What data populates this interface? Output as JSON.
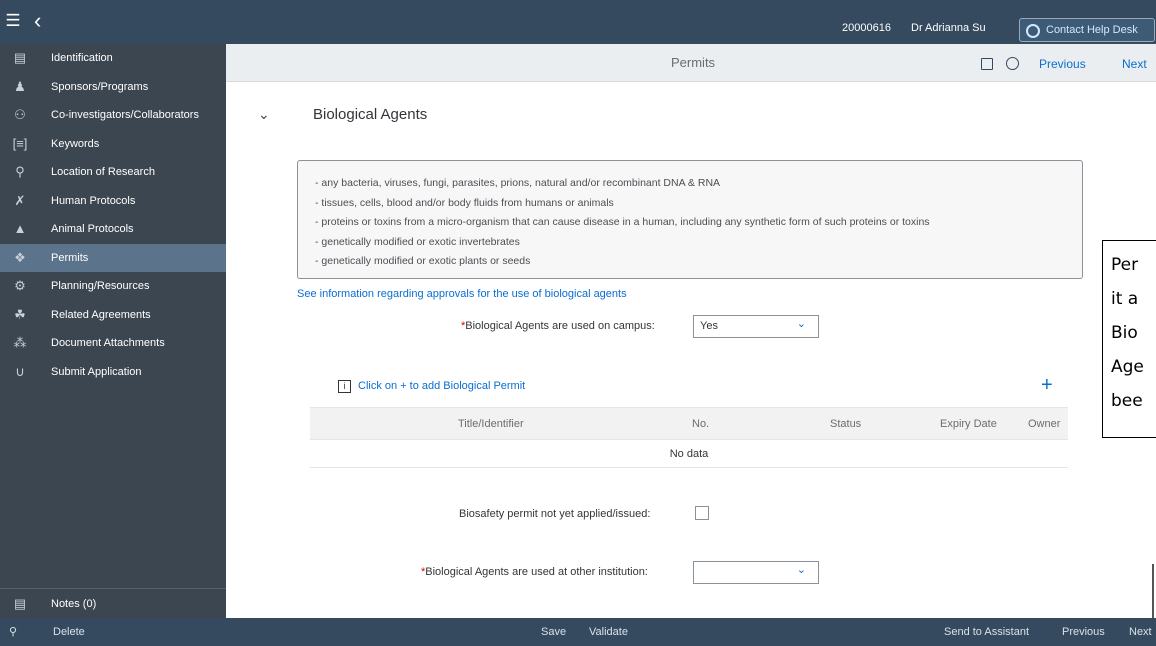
{
  "topbar": {
    "menu_icon": "hamburger-icon",
    "back_icon": "chevron-left-icon",
    "user_id": "20000616",
    "user_name": "Dr Adrianna Su",
    "help_label": "Contact Help Desk"
  },
  "sidebar": {
    "items": [
      {
        "label": "Identification",
        "icon": "id-card-icon"
      },
      {
        "label": "Sponsors/Programs",
        "icon": "group-icon"
      },
      {
        "label": "Co-investigators/Collaborators",
        "icon": "users-icon"
      },
      {
        "label": "Keywords",
        "icon": "bracket-list-icon"
      },
      {
        "label": "Location of Research",
        "icon": "location-icon"
      },
      {
        "label": "Human Protocols",
        "icon": "running-person-icon"
      },
      {
        "label": "Animal Protocols",
        "icon": "animal-icon"
      },
      {
        "label": "Permits",
        "icon": "permit-icon",
        "active": true
      },
      {
        "label": "Planning/Resources",
        "icon": "gear-icon"
      },
      {
        "label": "Related Agreements",
        "icon": "handshake-icon"
      },
      {
        "label": "Document Attachments",
        "icon": "paperclip-icon"
      },
      {
        "label": "Submit Application",
        "icon": "upload-icon"
      }
    ],
    "notes_label": "Notes (0)"
  },
  "page_header": {
    "title": "Permits",
    "previous_label": "Previous",
    "next_label": "Next"
  },
  "section": {
    "title": "Biological Agents",
    "info_lines": [
      "- any bacteria, viruses, fungi, parasites, prions, natural and/or recombinant DNA & RNA",
      "- tissues, cells, blood and/or body fluids from humans or animals",
      "- proteins or toxins from a micro-organism that can cause disease in a human, including any synthetic form of such proteins or toxins",
      "- genetically modified or exotic invertebrates",
      "- genetically modified or exotic plants or seeds"
    ],
    "info_link": "See information regarding approvals for the use of biological agents",
    "campus_label": "Biological Agents are used on campus:",
    "campus_value": "Yes",
    "add_permit_label": "Click on + to add Biological Permit",
    "table": {
      "columns": [
        "Title/Identifier",
        "No.",
        "Status",
        "Expiry Date",
        "Owner"
      ],
      "no_data": "No data"
    },
    "biosafety_label": "Biosafety permit not yet applied/issued:",
    "other_inst_label": "Biological Agents are used at other institution:",
    "other_inst_value": "",
    "required_mark": "*"
  },
  "bottombar": {
    "delete_label": "Delete",
    "save_label": "Save",
    "validate_label": "Validate",
    "send_label": "Send to Assistant",
    "previous_label": "Previous",
    "next_label": "Next"
  },
  "callout": {
    "lines": [
      "Per",
      "it a",
      "Bio",
      "Age",
      "bee"
    ]
  },
  "colors": {
    "shell": "#354a5f",
    "sidebar": "#3c4650",
    "active": "#5b738b",
    "link": "#0a6ed1",
    "required": "#dd0000"
  }
}
